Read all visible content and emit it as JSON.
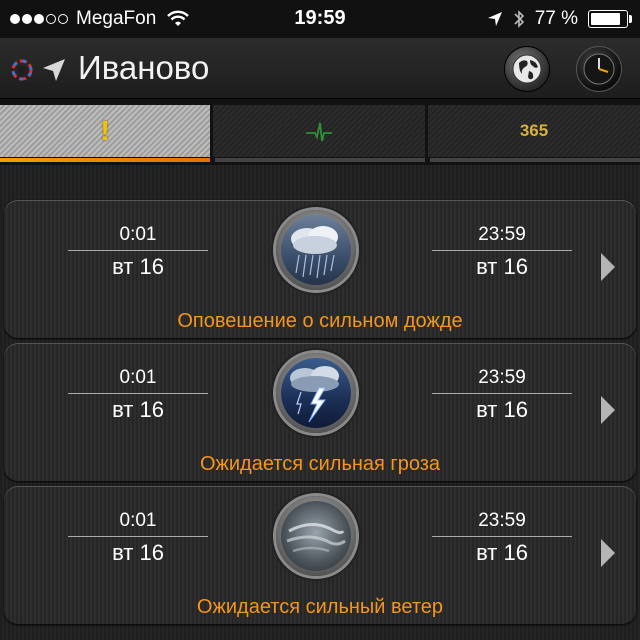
{
  "status": {
    "carrier": "MegaFon",
    "time": "19:59",
    "battery": "77 %",
    "battery_level": 0.77
  },
  "header": {
    "city": "Иваново"
  },
  "tabs": [
    {
      "label": "!",
      "active": true
    },
    {
      "label": "",
      "active": false
    },
    {
      "label": "365",
      "active": false
    }
  ],
  "alerts": [
    {
      "start_time": "0:01",
      "start_day": "вт 16",
      "end_time": "23:59",
      "end_day": "вт 16",
      "message": "Оповешение о сильном дожде",
      "icon": "heavy-rain-icon"
    },
    {
      "start_time": "0:01",
      "start_day": "вт 16",
      "end_time": "23:59",
      "end_day": "вт 16",
      "message": "Ожидается сильная гроза",
      "icon": "thunderstorm-icon"
    },
    {
      "start_time": "0:01",
      "start_day": "вт 16",
      "end_time": "23:59",
      "end_day": "вт 16",
      "message": "Ожидается сильный ветер",
      "icon": "strong-wind-icon"
    }
  ],
  "colors": {
    "accent": "#f4951c",
    "exclamation": "#f5c400",
    "tab_number": "#d6b040"
  }
}
